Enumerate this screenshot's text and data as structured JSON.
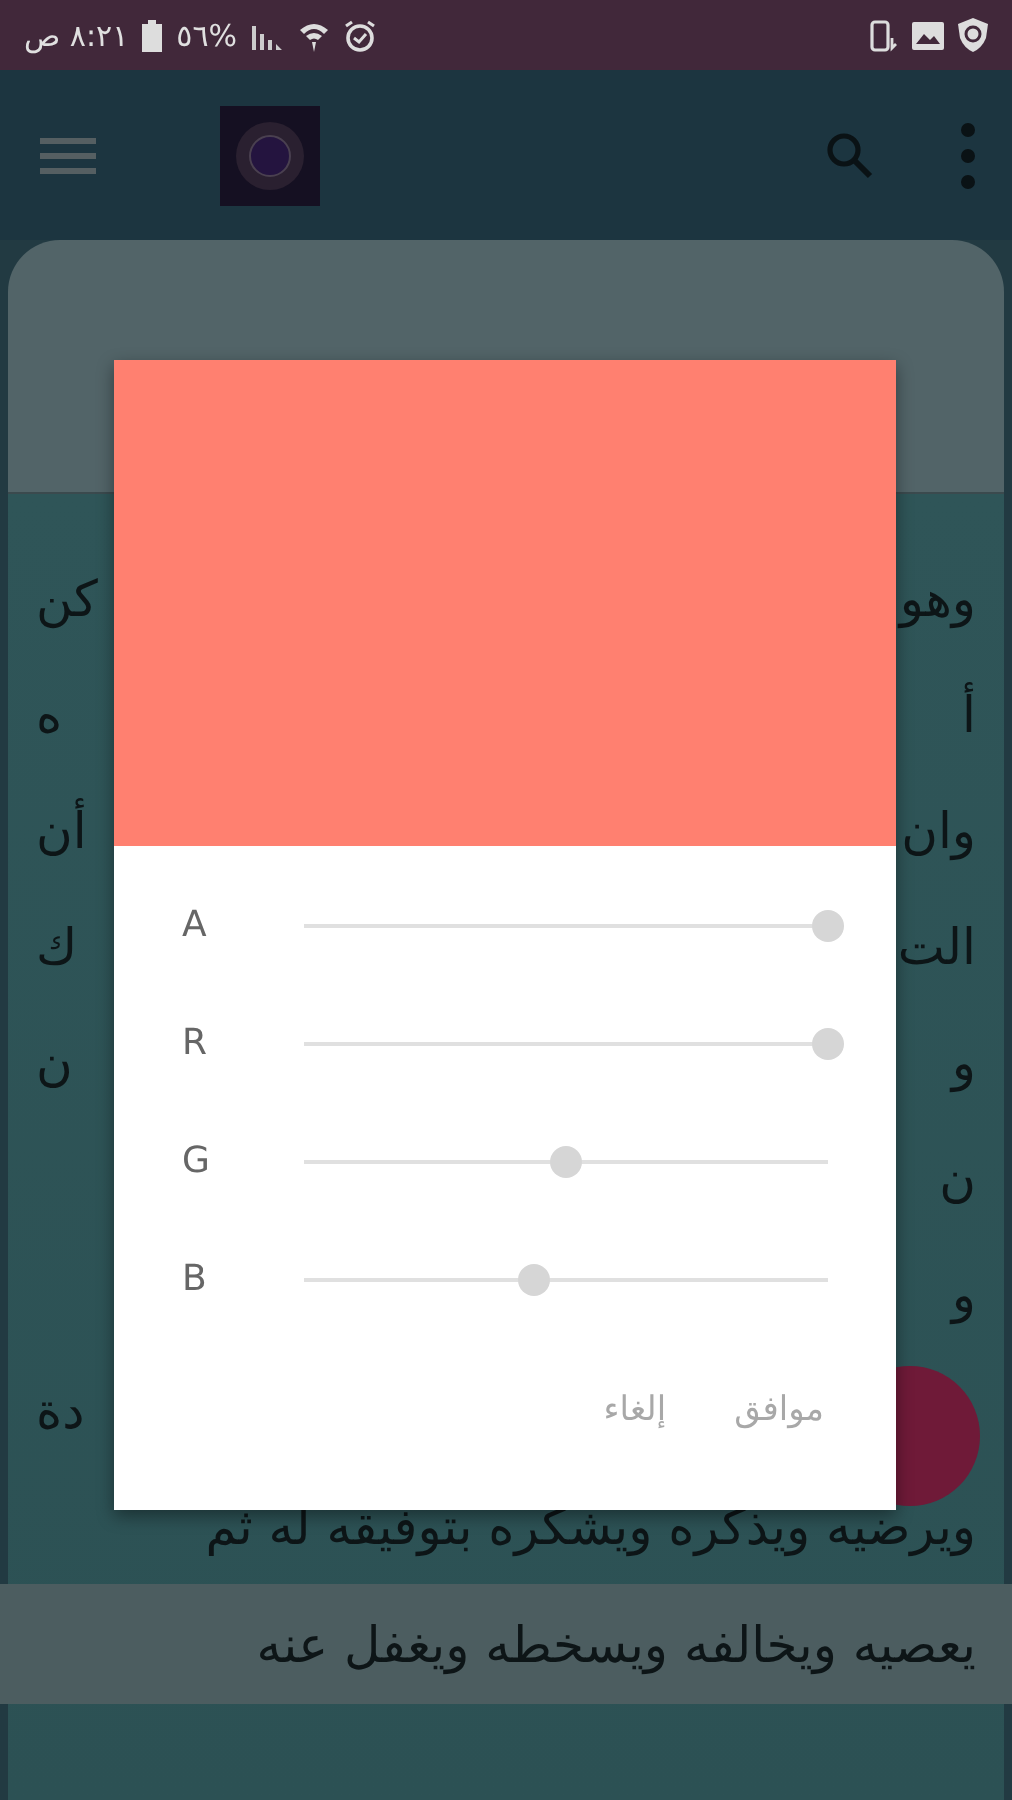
{
  "status_bar": {
    "time": "٨:٢١ ص",
    "battery": "%٥٦"
  },
  "article": {
    "lines": [
      {
        "start": "وهو",
        "end": "كن"
      },
      {
        "start": "أ",
        "end": "ه"
      },
      {
        "start": "وان",
        "end": "أن"
      },
      {
        "start": "الت",
        "end": "ك"
      },
      {
        "start": "و",
        "end": "ن"
      },
      {
        "start": "ن"
      },
      {
        "start": "و"
      },
      {
        "end": "دة"
      },
      {
        "start": "ويرضيه ويذكره ويشكره بتوفيقه له ثم"
      },
      {
        "start": "يعصيه ويخالفه ويسخطه ويغفل عنه"
      }
    ]
  },
  "color_dialog": {
    "channels": [
      {
        "label": "A",
        "level": 1.0
      },
      {
        "label": "R",
        "level": 1.0
      },
      {
        "label": "G",
        "level": 0.5
      },
      {
        "label": "B",
        "level": 0.44
      }
    ],
    "buttons": [
      {
        "label": "موافق",
        "disabled": true
      },
      {
        "label": "إلغاء",
        "disabled": true
      }
    ]
  }
}
